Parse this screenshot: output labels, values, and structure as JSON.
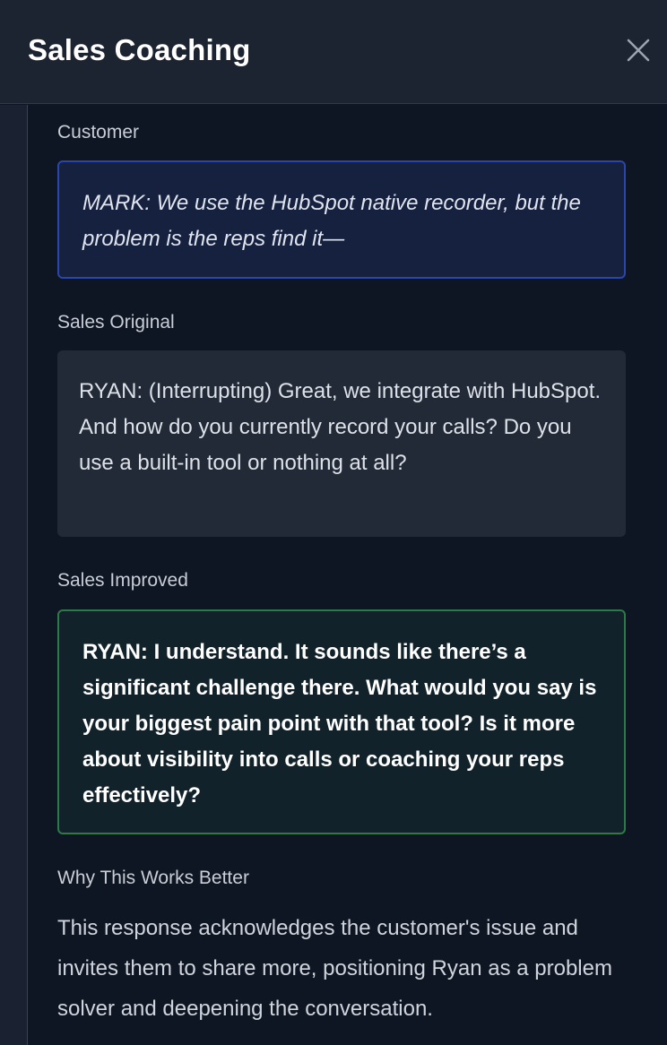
{
  "header": {
    "title": "Sales Coaching",
    "close_icon": "close-icon"
  },
  "sections": {
    "customer": {
      "label": "Customer",
      "text": "MARK: We use the HubSpot native recorder, but the problem is the reps find it—"
    },
    "original": {
      "label": "Sales Original",
      "text": "RYAN: (Interrupting) Great, we integrate with HubSpot. And how do you currently record your calls? Do you use a built-in tool or nothing at all?"
    },
    "improved": {
      "label": "Sales Improved",
      "text": "RYAN: I understand. It sounds like there’s a significant challenge there. What would you say is your biggest pain point with that tool? Is it more about visibility into calls or coaching your reps effectively?"
    },
    "why": {
      "label": "Why This Works Better",
      "text": "This response acknowledges the customer's issue and invites them to share more, positioning Ryan as a problem solver and deepening the conversation."
    }
  },
  "colors": {
    "background": "#0f1623",
    "header_bg": "#1c2432",
    "customer_border": "#2b45a8",
    "improved_border": "#2c7a48"
  }
}
